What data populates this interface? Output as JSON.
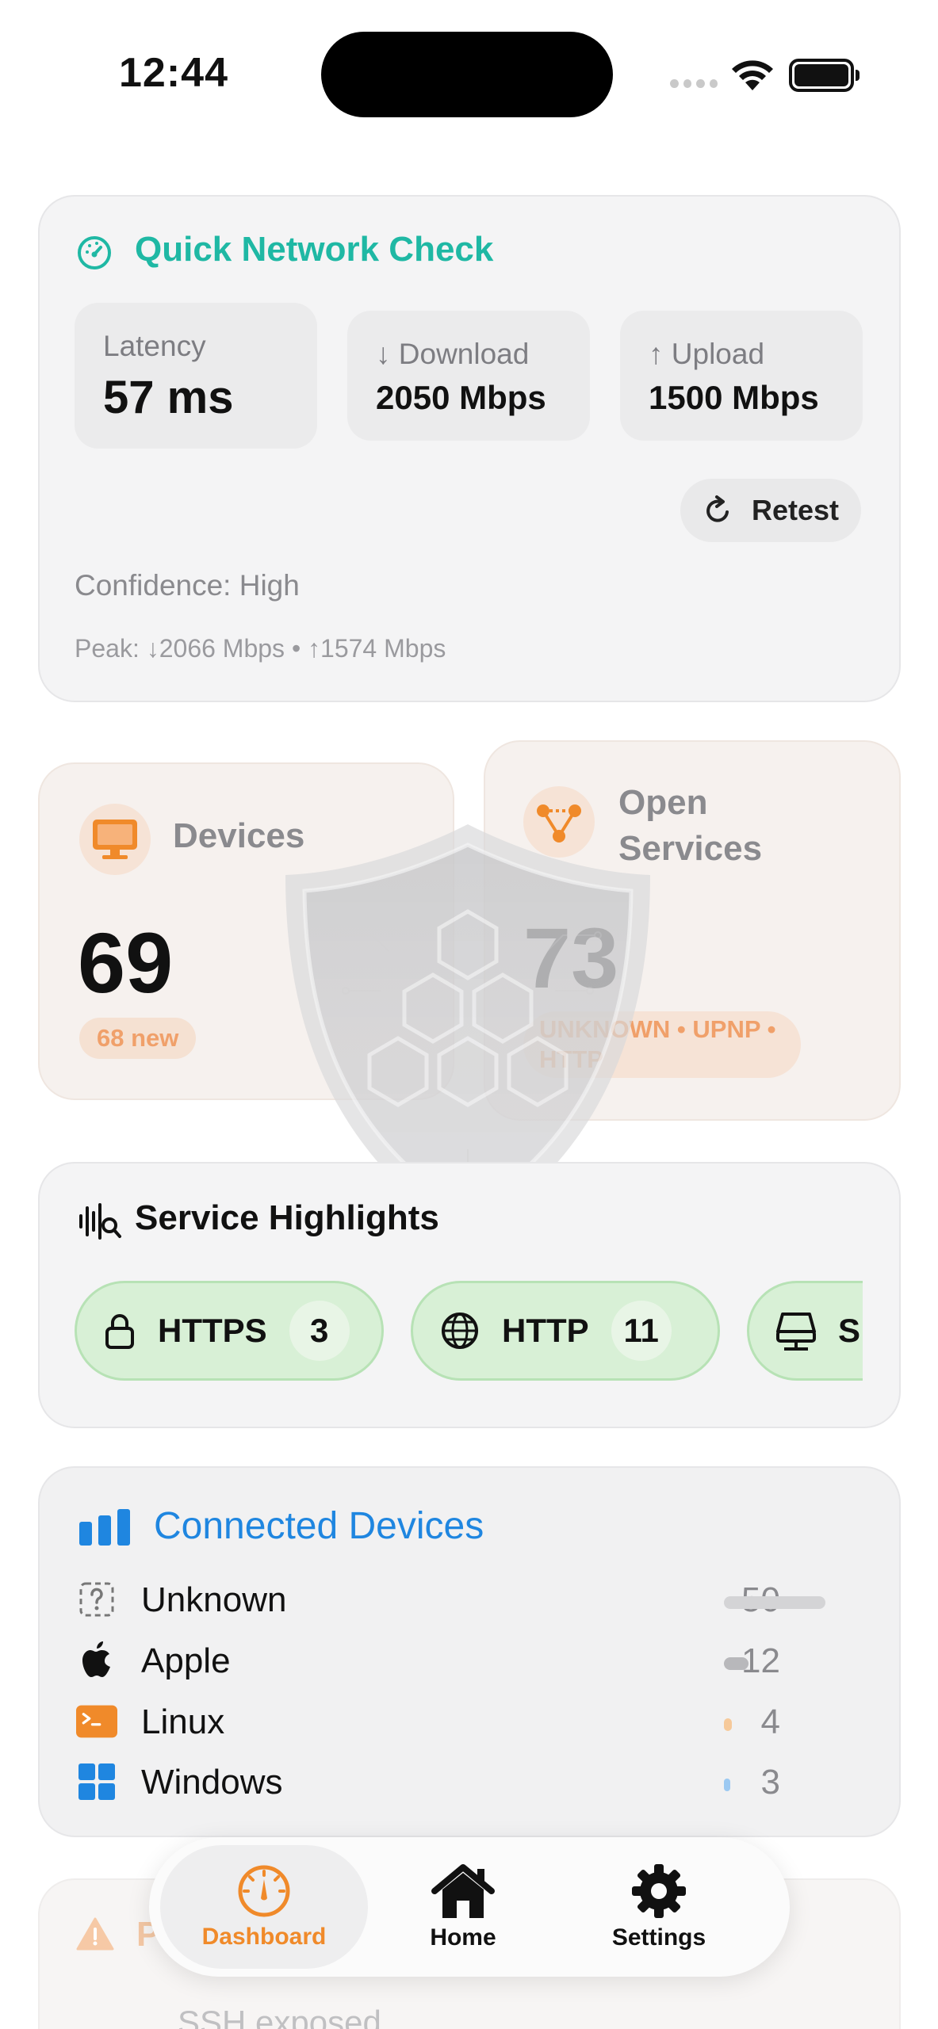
{
  "status_bar": {
    "time": "12:44"
  },
  "quick_check": {
    "title": "Quick Network Check",
    "latency": {
      "label": "Latency",
      "value": "57 ms"
    },
    "download": {
      "label": "↓ Download",
      "value": "2050 Mbps"
    },
    "upload": {
      "label": "↑ Upload",
      "value": "1500 Mbps"
    },
    "retest_label": "Retest",
    "confidence": "Confidence: High",
    "peak": "Peak: ↓2066 Mbps • ↑1574 Mbps",
    "accent": "#1fb8a4"
  },
  "devices": {
    "title": "Devices",
    "count": "69",
    "badge": "68 new"
  },
  "open_services": {
    "title": "Open Services",
    "count": "73",
    "badge": "UNKNOWN • UPNP • HTTP"
  },
  "service_highlights": {
    "title": "Service Highlights",
    "chips": [
      {
        "icon": "lock-icon",
        "name": "HTTPS",
        "count": "3"
      },
      {
        "icon": "globe-icon",
        "name": "HTTP",
        "count": "11"
      },
      {
        "icon": "server-icon",
        "name": "S",
        "count": ""
      }
    ]
  },
  "connected_devices": {
    "title": "Connected Devices",
    "accent": "#1f86e0",
    "items": [
      {
        "icon": "question-icon",
        "name": "Unknown",
        "count": "50",
        "fraction": 1.0,
        "color": "#d4d4d6"
      },
      {
        "icon": "apple-icon",
        "name": "Apple",
        "count": "12",
        "fraction": 0.24,
        "color": "#b8b8bb"
      },
      {
        "icon": "terminal-icon",
        "name": "Linux",
        "count": "4",
        "fraction": 0.08,
        "color": "#f6c99a"
      },
      {
        "icon": "windows-icon",
        "name": "Windows",
        "count": "3",
        "fraction": 0.06,
        "color": "#9cc9f2"
      }
    ]
  },
  "partial_card": {
    "title_letter": "P",
    "line": "SSH exposed"
  },
  "tabbar": {
    "tabs": [
      {
        "label": "Dashboard",
        "icon": "gauge-icon",
        "active": true
      },
      {
        "label": "Home",
        "icon": "house-icon",
        "active": false
      },
      {
        "label": "Settings",
        "icon": "gear-icon",
        "active": false
      }
    ],
    "active_color": "#f08a2a"
  }
}
